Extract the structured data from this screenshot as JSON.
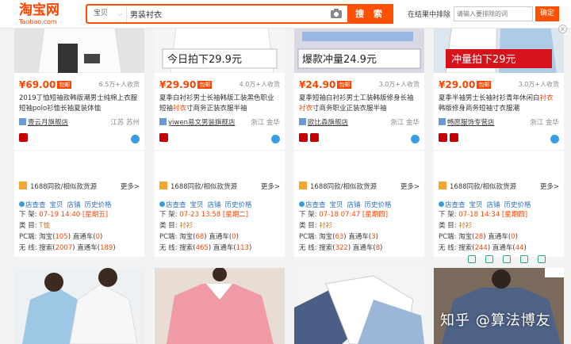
{
  "header": {
    "logo_main": "淘宝网",
    "logo_sub": "Taobao.com",
    "search_type": "宝贝",
    "search_query": "男装衬衣",
    "search_button": "搜 索",
    "filter_label": "在结果中排除",
    "filter_placeholder": "请输入要排除的词",
    "filter_ok": "确定"
  },
  "products": [
    {
      "price": "¥69.00",
      "baoyou": "包邮",
      "sales": "6.5万+人收货",
      "title_1": "2019丁恤",
      "title_hl": "",
      "title_2": "短袖款韩版潮男士纯棉上衣服 短袖polo衫恤长袖夏装体恤",
      "shop": "壹云月旗舰店",
      "location": "江苏 苏州",
      "same": "1688同款/相似款货源",
      "more": "更多>",
      "links": [
        "店查查",
        "宝贝",
        "店铺",
        "历史价格"
      ],
      "down": "07-19 14:40",
      "weekday": "[星期五]",
      "category": "T恤",
      "pc_tb": "105",
      "pc_ztc": "0",
      "wx_search": "2007",
      "wx_ztc": "189"
    },
    {
      "price": "¥29.90",
      "baoyou": "包邮",
      "sales": "4.0万+人收货",
      "title_1": "夏季白衬衫男士长袖韩版工装黑色职业短袖",
      "title_hl": "衬衣",
      "title_2": "寸商务正装衣服半袖",
      "shop": "yiwen易文男装旗舰店",
      "location": "浙江 金华",
      "same": "1688同款/相似款货源",
      "more": "更多>",
      "links": [
        "店查查",
        "宝贝",
        "店铺",
        "历史价格"
      ],
      "down": "07-23 13:58",
      "weekday": "[星期二]",
      "category": "衬衫",
      "pc_tb": "68",
      "pc_ztc": "0",
      "wx_search": "465",
      "wx_ztc": "113"
    },
    {
      "price": "¥24.90",
      "baoyou": "包邮",
      "sales": "3.0万+人收货",
      "title_1": "夏季短袖白衬衫男士工装韩版修身长袖",
      "title_hl": "衬衣",
      "title_2": "寸商务职业正装衣服半袖",
      "shop": "欧比森旗舰店",
      "location": "浙江 金华",
      "same": "1688同款/相似款货源",
      "more": "更多>",
      "links": [
        "店查查",
        "宝贝",
        "店铺",
        "历史价格"
      ],
      "down": "07-18 07:47",
      "weekday": "[星期四]",
      "category": "衬衫",
      "pc_tb": "63",
      "pc_ztc": "3",
      "wx_search": "322",
      "wx_ztc": "8"
    },
    {
      "price": "¥29.00",
      "baoyou": "包邮",
      "sales": "3.0万+人收货",
      "title_1": "夏季半袖男士长袖衬衫青年休闲白",
      "title_hl": "衬衣",
      "title_2": "韩版修身商务短袖寸衣服潮",
      "shop": "畅愿服饰专营店",
      "location": "浙江 金华",
      "same": "1688同款/相似款货源",
      "more": "更多>",
      "links": [
        "店查查",
        "宝贝",
        "店铺",
        "历史价格"
      ],
      "down": "07-18 14:34",
      "weekday": "[星期四]",
      "category": "衬衫",
      "pc_tb": "28",
      "pc_ztc": "0",
      "wx_search": "244",
      "wx_ztc": "44"
    }
  ],
  "banners": {
    "p2": "今日拍下29.9元",
    "p3": "爆款冲量24.9元",
    "p4": "冲量拍下29元"
  },
  "labels": {
    "down": "下 架:",
    "category": "类 目:",
    "pc": "PC端:",
    "wx": "无 线:",
    "taobao": "淘宝(",
    "ztc": "直通车(",
    "search": "搜索(",
    "close": ")"
  },
  "watermark": "知乎 @算法博友",
  "colors": {
    "accent": "#ff5000",
    "price": "#ff4400",
    "link": "#2a6ebb"
  }
}
